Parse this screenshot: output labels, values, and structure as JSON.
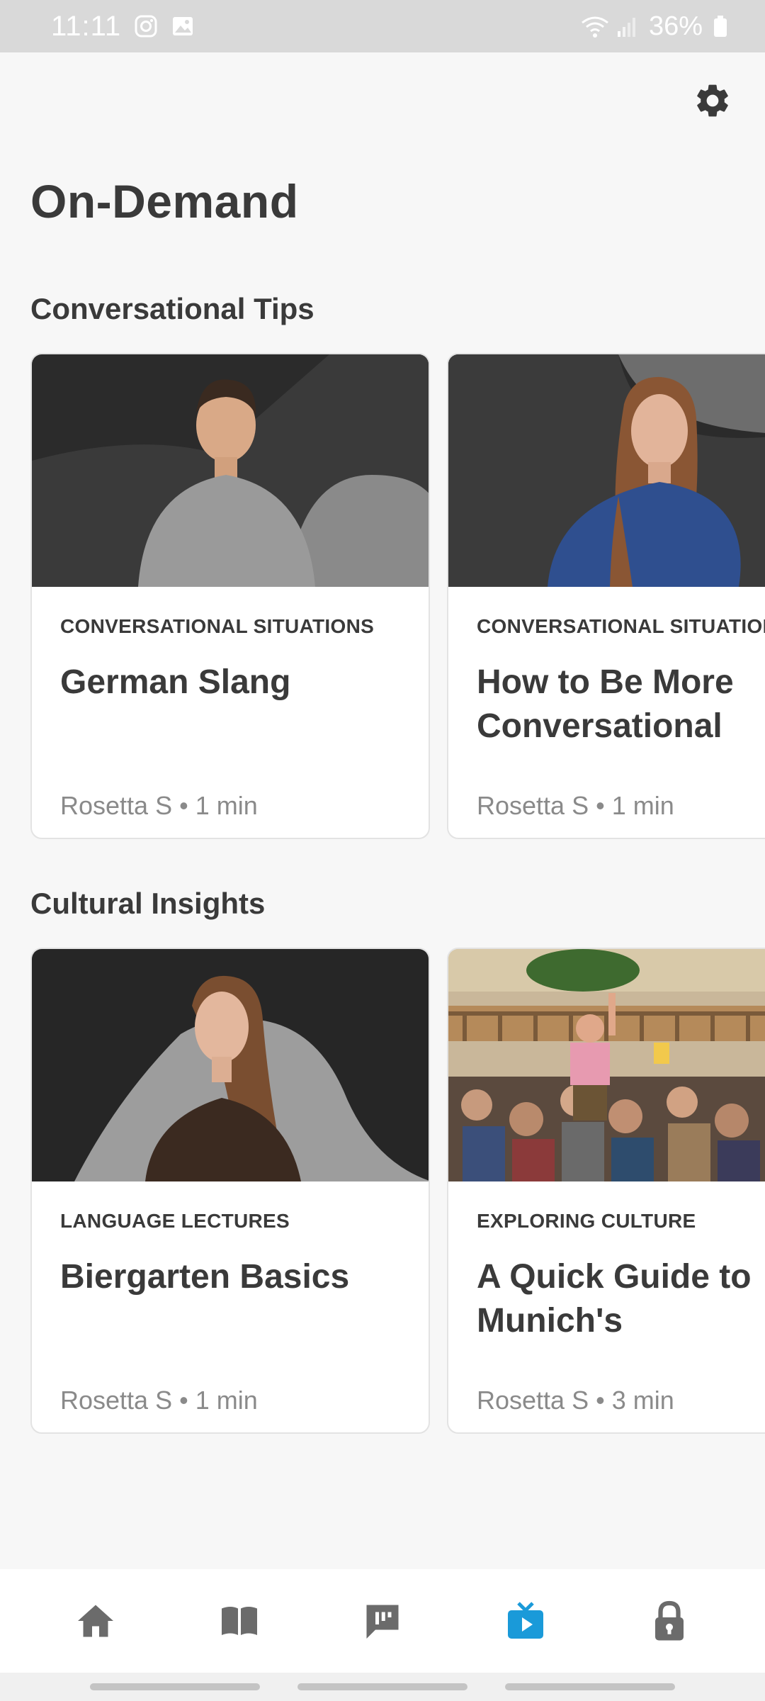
{
  "status_bar": {
    "time": "11:11",
    "battery": "36%",
    "icons": [
      "instagram-icon",
      "gallery-icon",
      "wifi-icon",
      "signal-icon",
      "battery-icon"
    ]
  },
  "header": {
    "settings_icon": "gear-icon",
    "title": "On-Demand"
  },
  "sections": [
    {
      "title": "Conversational Tips",
      "cards": [
        {
          "category": "CONVERSATIONAL SITUATIONS",
          "title": "German Slang",
          "meta": "Rosetta S • 1 min",
          "thumbnail": "man-presenter-thumbnail"
        },
        {
          "category": "CONVERSATIONAL SITUATIONS",
          "title": "How to Be More Conversational",
          "meta": "Rosetta S • 1 min",
          "thumbnail": "woman-presenter-thumbnail"
        }
      ]
    },
    {
      "title": "Cultural Insights",
      "cards": [
        {
          "category": "LANGUAGE LECTURES",
          "title": "Biergarten Basics",
          "meta": "Rosetta S • 1 min",
          "thumbnail": "woman-lecturer-thumbnail"
        },
        {
          "category": "EXPLORING CULTURE",
          "title": "A Quick Guide to Munich's",
          "meta": "Rosetta S • 3 min",
          "thumbnail": "beer-hall-crowd-thumbnail"
        }
      ]
    }
  ],
  "bottom_nav": {
    "items": [
      {
        "icon": "home-icon",
        "active": false
      },
      {
        "icon": "book-icon",
        "active": false
      },
      {
        "icon": "chat-bubble-icon",
        "active": false
      },
      {
        "icon": "tv-play-icon",
        "active": true
      },
      {
        "icon": "lock-icon",
        "active": false
      }
    ],
    "active_color": "#1a9ad9",
    "inactive_color": "#6b6b6b"
  }
}
